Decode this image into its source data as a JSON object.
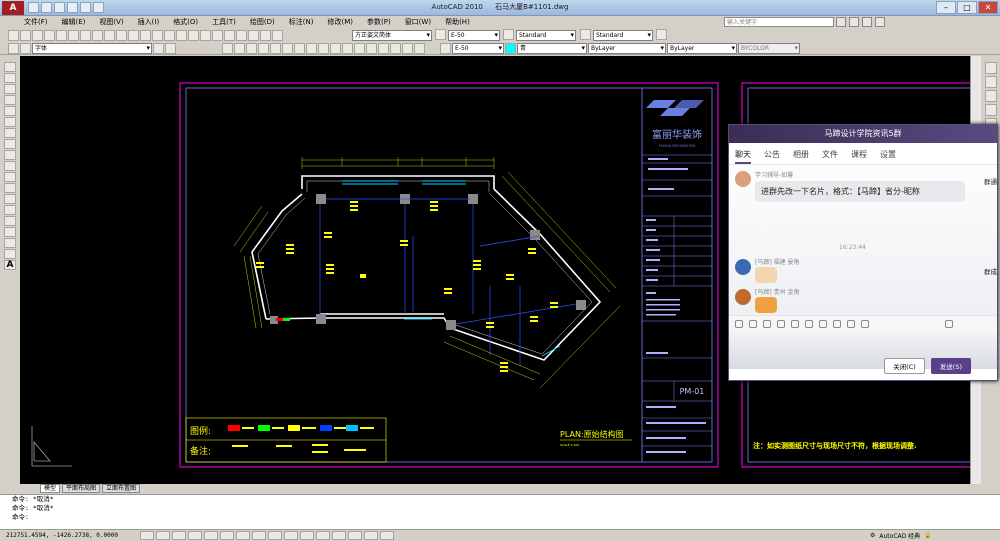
{
  "app": {
    "logo_letter": "A",
    "title": "AutoCAD 2010",
    "document": "石马大厦B#1101.dwg"
  },
  "menu": [
    "文件(F)",
    "编辑(E)",
    "视图(V)",
    "插入(I)",
    "格式(O)",
    "工具(T)",
    "绘图(D)",
    "标注(N)",
    "修改(M)",
    "参数(P)",
    "窗口(W)",
    "帮助(H)"
  ],
  "search": {
    "placeholder": "输入关键字"
  },
  "toolbar": {
    "layer_combo": "字体",
    "text_style": "方正姿文简体",
    "dim_scale_1": "E-50",
    "dim_style": "Standard",
    "table_style": "Standard",
    "dim_scale_2": "E-50",
    "color": "青",
    "linetype": "ByLayer",
    "lineweight": "ByLayer",
    "plot_style": "BYCOLOR"
  },
  "tabs": [
    "模型",
    "平面布局图",
    "立面布置图"
  ],
  "command": {
    "lines": [
      "命令: *取消*",
      "命令: *取消*",
      "命令:"
    ]
  },
  "status": {
    "coords": "212751.4594,  -1426.2738,  0.0000",
    "workspace": "AutoCAD 经典"
  },
  "drawing": {
    "company_cn": "富丽华装饰",
    "company_en": "FUHUA DECORATION",
    "plan_title": "PLAN:原始结构图",
    "plan_scale": "SCALE 1:100",
    "legend_label": "图例:",
    "remark_label": "备注:",
    "sheet_no": "PM-01",
    "note": "注：如实测图纸尺寸与现场尺寸不符，根据现场调整."
  },
  "chat": {
    "group": "马蹄设计学院资讯5群",
    "tabs": [
      "聊天",
      "公告",
      "相册",
      "文件",
      "课程",
      "设置"
    ],
    "active_tab": "聊天",
    "msg1_nick": "学习辅导-如馨",
    "msg1_text": "进群先改一下名片，格式：【马蹄】省分-昵称",
    "time": "16:23:44",
    "msg2_nick": "[马蹄] 福建 曼角",
    "msg3_nick": "[马蹄] 贵州 金角",
    "close_label": "关闭(C)",
    "send_label": "发送(S)",
    "side_label_1": "群通",
    "side_label_2": "群成"
  },
  "colors": {
    "canvas": "#000000",
    "frame": "#ff00ff",
    "accent": "#ffff00",
    "wall": "#ffffff",
    "chat_header": "#3a2d55"
  }
}
